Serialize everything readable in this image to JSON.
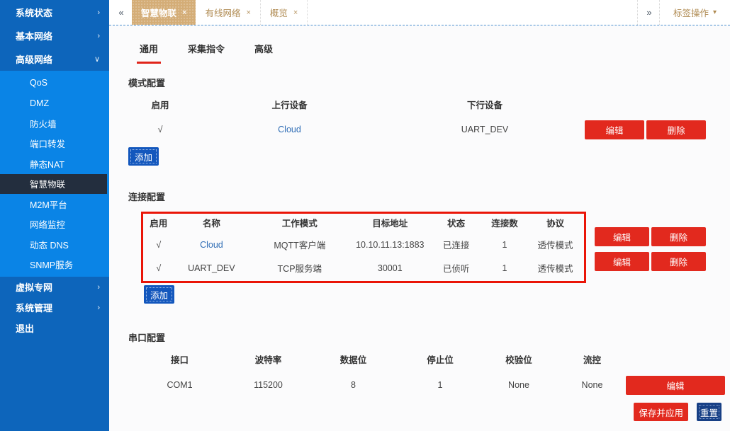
{
  "icons": {
    "back": "«",
    "forward": "»",
    "close": "×",
    "caret_down": "▾",
    "chevron_right": "›",
    "chevron_down": "∨",
    "check": "√"
  },
  "colors": {
    "sidebar_blue": "#0d65bb",
    "submenu_blue": "#0a84e6",
    "selected_dark": "#232e3e",
    "tab_active_tan": "#d4ad77",
    "tab_text_tan": "#b08b52",
    "button_red": "#e2291e",
    "button_blue": "#1357bd",
    "annotation_red": "#ea1508",
    "active_tab_underline": "#e0241a"
  },
  "sidebar": {
    "items_top": [
      {
        "label": "系统状态"
      },
      {
        "label": "基本网络"
      },
      {
        "label": "高级网络"
      }
    ],
    "submenu": {
      "items": [
        "QoS",
        "DMZ",
        "防火墙",
        "端口转发",
        "静态NAT",
        "智慧物联",
        "M2M平台",
        "网络监控",
        "动态 DNS",
        "SNMP服务"
      ],
      "selected": "智慧物联"
    },
    "items_bottom": [
      {
        "label": "虚拟专网"
      },
      {
        "label": "系统管理"
      },
      {
        "label": "退出"
      }
    ]
  },
  "tabbar": {
    "tabs": [
      {
        "label": "智慧物联",
        "active": true
      },
      {
        "label": "有线网络",
        "active": false
      },
      {
        "label": "概览",
        "active": false
      }
    ],
    "actions_label": "标签操作"
  },
  "page_tabs": {
    "items": [
      "通用",
      "采集指令",
      "高级"
    ],
    "active": "通用"
  },
  "mode_config": {
    "title": "模式配置",
    "headers": [
      "启用",
      "上行设备",
      "下行设备"
    ],
    "row": {
      "enabled": "√",
      "uplink": "Cloud",
      "downlink": "UART_DEV"
    },
    "edit_label": "编辑",
    "delete_label": "删除",
    "add_label": "添加"
  },
  "conn_config": {
    "title": "连接配置",
    "headers": [
      "启用",
      "名称",
      "工作模式",
      "目标地址",
      "状态",
      "连接数",
      "协议"
    ],
    "rows": [
      {
        "enabled": "√",
        "name": "Cloud",
        "mode": "MQTT客户端",
        "target": "10.10.11.13:1883",
        "status": "已连接",
        "connections": "1",
        "protocol": "透传模式"
      },
      {
        "enabled": "√",
        "name": "UART_DEV",
        "mode": "TCP服务端",
        "target": "30001",
        "status": "已侦听",
        "connections": "1",
        "protocol": "透传模式"
      }
    ],
    "edit_label": "编辑",
    "delete_label": "删除",
    "add_label": "添加"
  },
  "serial_config": {
    "title": "串口配置",
    "headers": [
      "接口",
      "波特率",
      "数据位",
      "停止位",
      "校验位",
      "流控"
    ],
    "row": {
      "port": "COM1",
      "baud": "115200",
      "data_bits": "8",
      "stop_bits": "1",
      "parity": "None",
      "flow": "None"
    },
    "edit_label": "编辑"
  },
  "footer": {
    "save_label": "保存并应用",
    "reset_label": "重置"
  }
}
